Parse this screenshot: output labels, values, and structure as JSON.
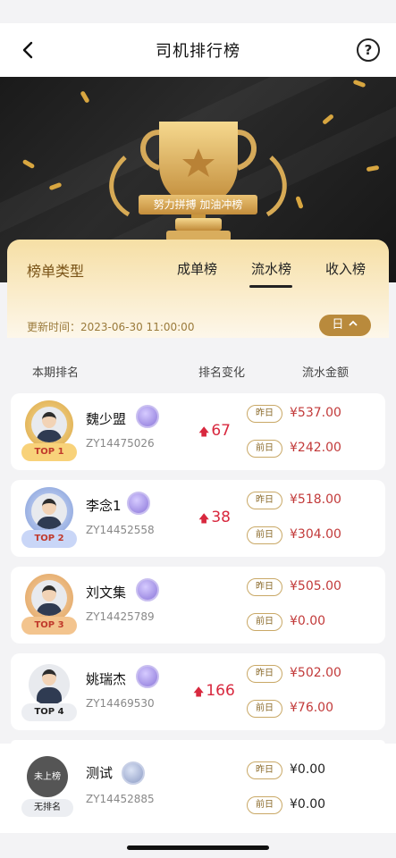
{
  "nav": {
    "title": "司机排行榜",
    "back_glyph": "‹",
    "help_glyph": "?"
  },
  "banner": {
    "slogan": "努力拼搏 加油冲榜"
  },
  "panel": {
    "label": "榜单类型",
    "tabs": [
      "成单榜",
      "流水榜",
      "收入榜"
    ],
    "active_tab": "流水榜",
    "update_text": "更新时间：2023-06-30 11:00:00",
    "period": "日"
  },
  "columns": {
    "rank": "本期排名",
    "change": "排名变化",
    "amount": "流水金额"
  },
  "pill_labels": {
    "yesterday": "昨日",
    "day_before": "前日"
  },
  "drivers": [
    {
      "name": "魏少盟",
      "id": "ZY14475026",
      "badge": "TOP 1",
      "change": "67",
      "yesterday": "¥537.00",
      "day_before": "¥242.00"
    },
    {
      "name": "李念1",
      "id": "ZY14452558",
      "badge": "TOP 2",
      "change": "38",
      "yesterday": "¥518.00",
      "day_before": "¥304.00"
    },
    {
      "name": "刘文集",
      "id": "ZY14425789",
      "badge": "TOP 3",
      "change": "",
      "yesterday": "¥505.00",
      "day_before": "¥0.00"
    },
    {
      "name": "姚瑞杰",
      "id": "ZY14469530",
      "badge": "TOP 4",
      "change": "166",
      "yesterday": "¥502.00",
      "day_before": "¥76.00"
    }
  ],
  "me": {
    "name": "测试",
    "id": "ZY14452885",
    "avatar_text": "未上榜",
    "badge": "无排名",
    "yesterday": "¥0.00",
    "day_before": "¥0.00"
  },
  "colors": {
    "gold": "#b98a3c",
    "red": "#d8283e",
    "silver": "#7f9ad6",
    "bronze": "#e0a15a"
  }
}
